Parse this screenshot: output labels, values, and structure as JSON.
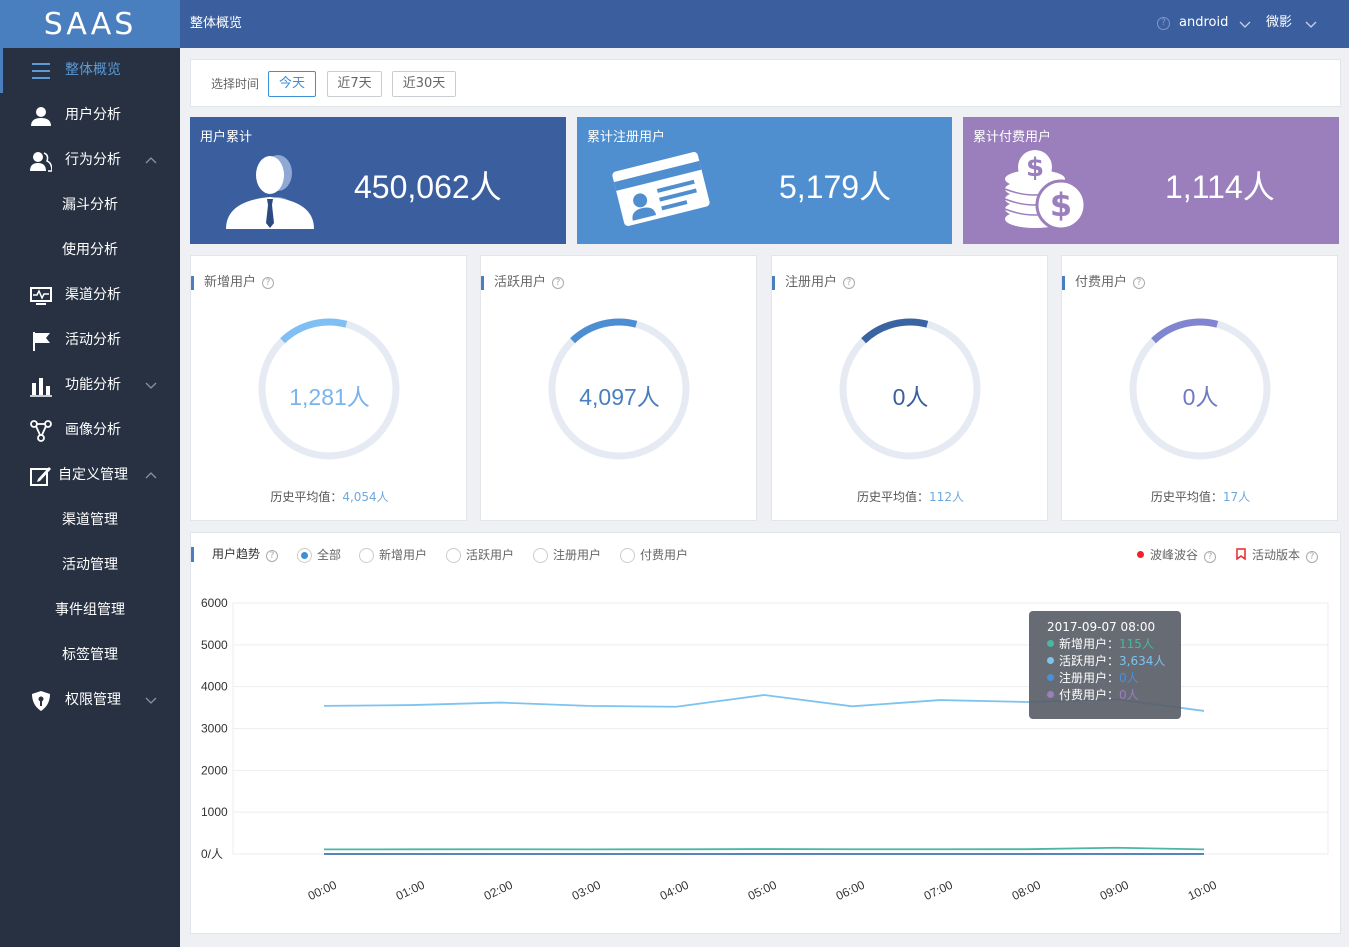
{
  "logo": "SAAS",
  "sidebar": {
    "items": [
      {
        "label": "整体概览",
        "icon": "menu-icon"
      },
      {
        "label": "用户分析",
        "icon": "user-icon"
      },
      {
        "label": "行为分析",
        "icon": "users-icon"
      },
      {
        "label": "漏斗分析"
      },
      {
        "label": "使用分析"
      },
      {
        "label": "渠道分析",
        "icon": "monitor-icon"
      },
      {
        "label": "活动分析",
        "icon": "flag-icon"
      },
      {
        "label": "功能分析",
        "icon": "bar-chart-icon"
      },
      {
        "label": "画像分析",
        "icon": "network-icon"
      },
      {
        "label": "自定义管理",
        "icon": "edit-icon"
      },
      {
        "label": "渠道管理"
      },
      {
        "label": "活动管理"
      },
      {
        "label": "事件组管理"
      },
      {
        "label": "标签管理"
      },
      {
        "label": "权限管理",
        "icon": "shield-icon"
      }
    ]
  },
  "header": {
    "title": "整体概览",
    "help": "?",
    "platform": "android",
    "app": "微影"
  },
  "timefilter": {
    "label": "选择时间",
    "options": [
      "今天",
      "近7天",
      "近30天"
    ],
    "selected": "今天"
  },
  "stats": [
    {
      "title": "用户累计",
      "value": "450,062人",
      "color": "#3b5f9e",
      "icon": "businessman-icon"
    },
    {
      "title": "累计注册用户",
      "value": "5,179人",
      "color": "#4f8fd0",
      "icon": "id-card-icon"
    },
    {
      "title": "累计付费用户",
      "value": "1,114人",
      "color": "#9a7fbc",
      "icon": "coins-icon"
    }
  ],
  "rings": [
    {
      "title": "新增用户",
      "value": "1,281人",
      "avg_label": "历史平均值：",
      "avg": "4,054人",
      "color": "#80bff4",
      "text_color": "#79b4ec"
    },
    {
      "title": "活跃用户",
      "value": "4,097人",
      "avg_label": "",
      "avg": "",
      "color": "#4d8ed2",
      "text_color": "#4a7fbf"
    },
    {
      "title": "注册用户",
      "value": "0人",
      "avg_label": "历史平均值：",
      "avg": "112人",
      "color": "#3a63a2",
      "text_color": "#3b5f9e"
    },
    {
      "title": "付费用户",
      "value": "0人",
      "avg_label": "历史平均值：",
      "avg": "17人",
      "color": "#7f86cf",
      "text_color": "#6f79c4"
    }
  ],
  "trend": {
    "title": "用户趋势",
    "filters": [
      "全部",
      "新增用户",
      "活跃用户",
      "注册用户",
      "付费用户"
    ],
    "selected_filter": "全部",
    "peak_label": "波峰波谷",
    "version_label": "活动版本"
  },
  "chart_data": {
    "type": "line",
    "x": [
      "00:00",
      "01:00",
      "02:00",
      "03:00",
      "04:00",
      "05:00",
      "06:00",
      "07:00",
      "08:00",
      "09:00",
      "10:00"
    ],
    "y_ticks": [
      "0/人",
      "1000",
      "2000",
      "3000",
      "4000",
      "5000",
      "6000"
    ],
    "ylim": [
      0,
      6000
    ],
    "grid": true,
    "series": [
      {
        "name": "活跃用户",
        "color": "#7cc4f0",
        "values": [
          3540,
          3560,
          3620,
          3540,
          3520,
          3800,
          3530,
          3680,
          3634,
          3700,
          3420
        ]
      },
      {
        "name": "新增用户",
        "color": "#4ab7a3",
        "values": [
          110,
          112,
          113,
          111,
          112,
          118,
          113,
          114,
          115,
          150,
          110
        ]
      },
      {
        "name": "注册用户",
        "color": "#4a7fbf",
        "values": [
          0,
          0,
          0,
          0,
          0,
          0,
          0,
          0,
          0,
          0,
          0
        ]
      },
      {
        "name": "付费用户",
        "color": "#9a7fbc",
        "values": [
          0,
          0,
          0,
          0,
          0,
          0,
          0,
          0,
          0,
          0,
          0
        ]
      }
    ],
    "tooltip": {
      "title": "2017-09-07 08:00",
      "rows": [
        {
          "label": "新增用户：",
          "value": "115人",
          "color": "#4ab7a3"
        },
        {
          "label": "活跃用户：",
          "value": "3,634人",
          "color": "#7cc4f0"
        },
        {
          "label": "注册用户：",
          "value": "0人",
          "color": "#4a90d9"
        },
        {
          "label": "付费用户：",
          "value": "0人",
          "color": "#9a7fbc"
        }
      ]
    }
  }
}
